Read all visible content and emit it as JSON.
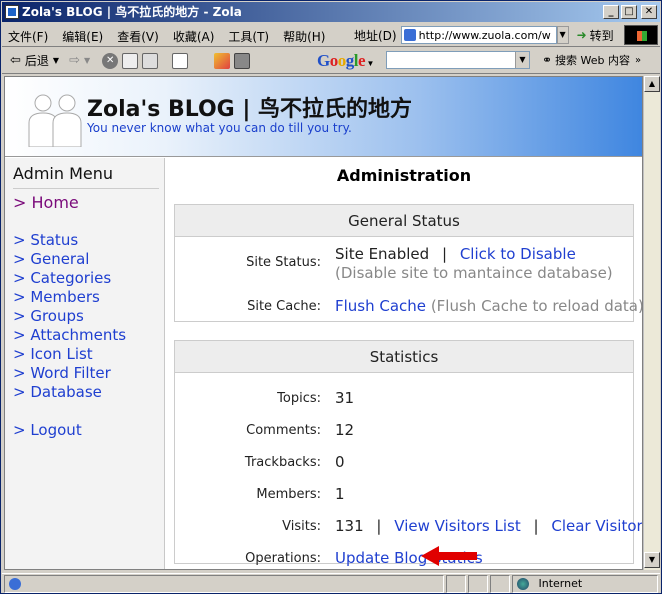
{
  "window": {
    "title": "Zola's BLOG | 鸟不拉氏的地方 - Zola",
    "buttons": {
      "minimize": "_",
      "maximize": "□",
      "close": "✕"
    }
  },
  "menubar": {
    "items": [
      "文件(F)",
      "编辑(E)",
      "查看(V)",
      "收藏(A)",
      "工具(T)",
      "帮助(H)"
    ],
    "address_label": "地址(D)",
    "address_value": "http://www.zuola.com/w",
    "go_label": "转到"
  },
  "toolbar": {
    "back_label": "后退",
    "google_logo": "Google",
    "search_web_label": "搜索 Web 内容"
  },
  "blog": {
    "title": "Zola's BLOG | 鸟不拉氏的地方",
    "subtitle": "You never know what you can do till you try."
  },
  "sidebar": {
    "title": "Admin Menu",
    "home": "> Home",
    "items": [
      "> Status",
      "> General",
      "> Categories",
      "> Members",
      "> Groups",
      "> Attachments",
      "> Icon List",
      "> Word Filter",
      "> Database"
    ],
    "logout": "> Logout"
  },
  "main": {
    "title": "Administration",
    "general": {
      "header": "General Status",
      "site_status_label": "Site Status:",
      "site_status_value": "Site Enabled",
      "separator": "|",
      "disable_link": "Click to Disable",
      "disable_note": "(Disable site to mantaince database)",
      "site_cache_label": "Site Cache:",
      "flush_link": "Flush Cache",
      "flush_note": "(Flush Cache to reload data)"
    },
    "stats": {
      "header": "Statistics",
      "topics_label": "Topics:",
      "topics": "31",
      "comments_label": "Comments:",
      "comments": "12",
      "trackbacks_label": "Trackbacks:",
      "trackbacks": "0",
      "members_label": "Members:",
      "members": "1",
      "visits_label": "Visits:",
      "visits": "131",
      "sep": "|",
      "view_visitors": "View Visitors List",
      "clear_visitors": "Clear Visitors List",
      "operations_label": "Operations:",
      "update_link": "Update Blog Statics"
    }
  },
  "statusbar": {
    "zone": "Internet"
  },
  "colors": {
    "link": "#1f3fd0",
    "home": "#7a0a7a",
    "arrow": "#e00000",
    "titlebar": "#0a246a"
  }
}
